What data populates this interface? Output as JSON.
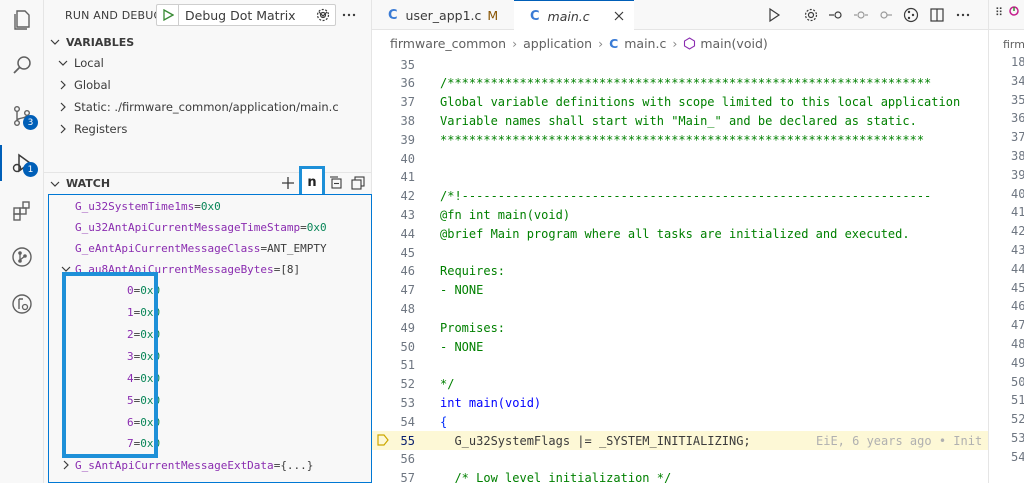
{
  "activity_bar": {
    "source_control_badge": "3",
    "debug_badge": "1"
  },
  "debug": {
    "title": "RUN AND DEBUG",
    "config_name": "Debug Dot Matrix"
  },
  "sections": {
    "variables": "VARIABLES",
    "watch": "WATCH",
    "watch_n_button": "n"
  },
  "variables": [
    {
      "label": "Local",
      "expanded": true
    },
    {
      "label": "Global",
      "expanded": false
    },
    {
      "label": "Static: ./firmware_common/application/main.c",
      "expanded": false
    },
    {
      "label": "Registers",
      "expanded": false
    }
  ],
  "watch": [
    {
      "name": "G_u32SystemTime1ms",
      "value": "0x0"
    },
    {
      "name": "G_u32AntApiCurrentMessageTimeStamp",
      "value": "0x0"
    },
    {
      "name": "G_eAntApiCurrentMessageClass",
      "value": "ANT_EMPTY"
    },
    {
      "name": "G_au8AntApiCurrentMessageBytes",
      "value": "[8]"
    },
    {
      "name": "0",
      "value": "0x0"
    },
    {
      "name": "1",
      "value": "0x0"
    },
    {
      "name": "2",
      "value": "0x0"
    },
    {
      "name": "3",
      "value": "0x0"
    },
    {
      "name": "4",
      "value": "0x0"
    },
    {
      "name": "5",
      "value": "0x0"
    },
    {
      "name": "6",
      "value": "0x0"
    },
    {
      "name": "7",
      "value": "0x0"
    },
    {
      "name": "G_sAntApiCurrentMessageExtData",
      "value": "{...}"
    }
  ],
  "tabs": [
    {
      "label": "user_app1.c",
      "modified": "M"
    },
    {
      "label": "main.c"
    }
  ],
  "breadcrumb": [
    "firmware_common",
    "application",
    "main.c",
    "main(void)"
  ],
  "code_lines": [
    {
      "num": "35",
      "text": ""
    },
    {
      "num": "36",
      "text": "/*******************************************************************"
    },
    {
      "num": "37",
      "text": "Global variable definitions with scope limited to this local application"
    },
    {
      "num": "38",
      "text": "Variable names shall start with \"Main_\" and be declared as static."
    },
    {
      "num": "39",
      "text": "*******************************************************************"
    },
    {
      "num": "40",
      "text": ""
    },
    {
      "num": "41",
      "text": ""
    },
    {
      "num": "42",
      "text": "/*!-----------------------------------------------------------------"
    },
    {
      "num": "43",
      "text": "@fn int main(void)"
    },
    {
      "num": "44",
      "text": "@brief Main program where all tasks are initialized and executed."
    },
    {
      "num": "45",
      "text": ""
    },
    {
      "num": "46",
      "text": "Requires:"
    },
    {
      "num": "47",
      "text": "- NONE"
    },
    {
      "num": "48",
      "text": ""
    },
    {
      "num": "49",
      "text": "Promises:"
    },
    {
      "num": "50",
      "text": "- NONE"
    },
    {
      "num": "51",
      "text": ""
    },
    {
      "num": "52",
      "text": "*/"
    },
    {
      "num": "53",
      "text": "int main(void)"
    },
    {
      "num": "54",
      "text": "{"
    },
    {
      "num": "55",
      "text": "  G_u32SystemFlags |= _SYSTEM_INITIALIZING;"
    },
    {
      "num": "56",
      "text": ""
    },
    {
      "num": "57",
      "text": "  /* Low level initialization */"
    }
  ],
  "blame": "EiE, 6 years ago • Init",
  "right_panel": {
    "header": "firm",
    "numbers": [
      "18",
      "34",
      "35",
      "36",
      "37",
      "38",
      "39",
      "40",
      "41",
      "42",
      "43",
      "44",
      "45",
      "46",
      "47",
      "48",
      "49",
      "50",
      "51",
      "52",
      "53",
      "54"
    ]
  }
}
